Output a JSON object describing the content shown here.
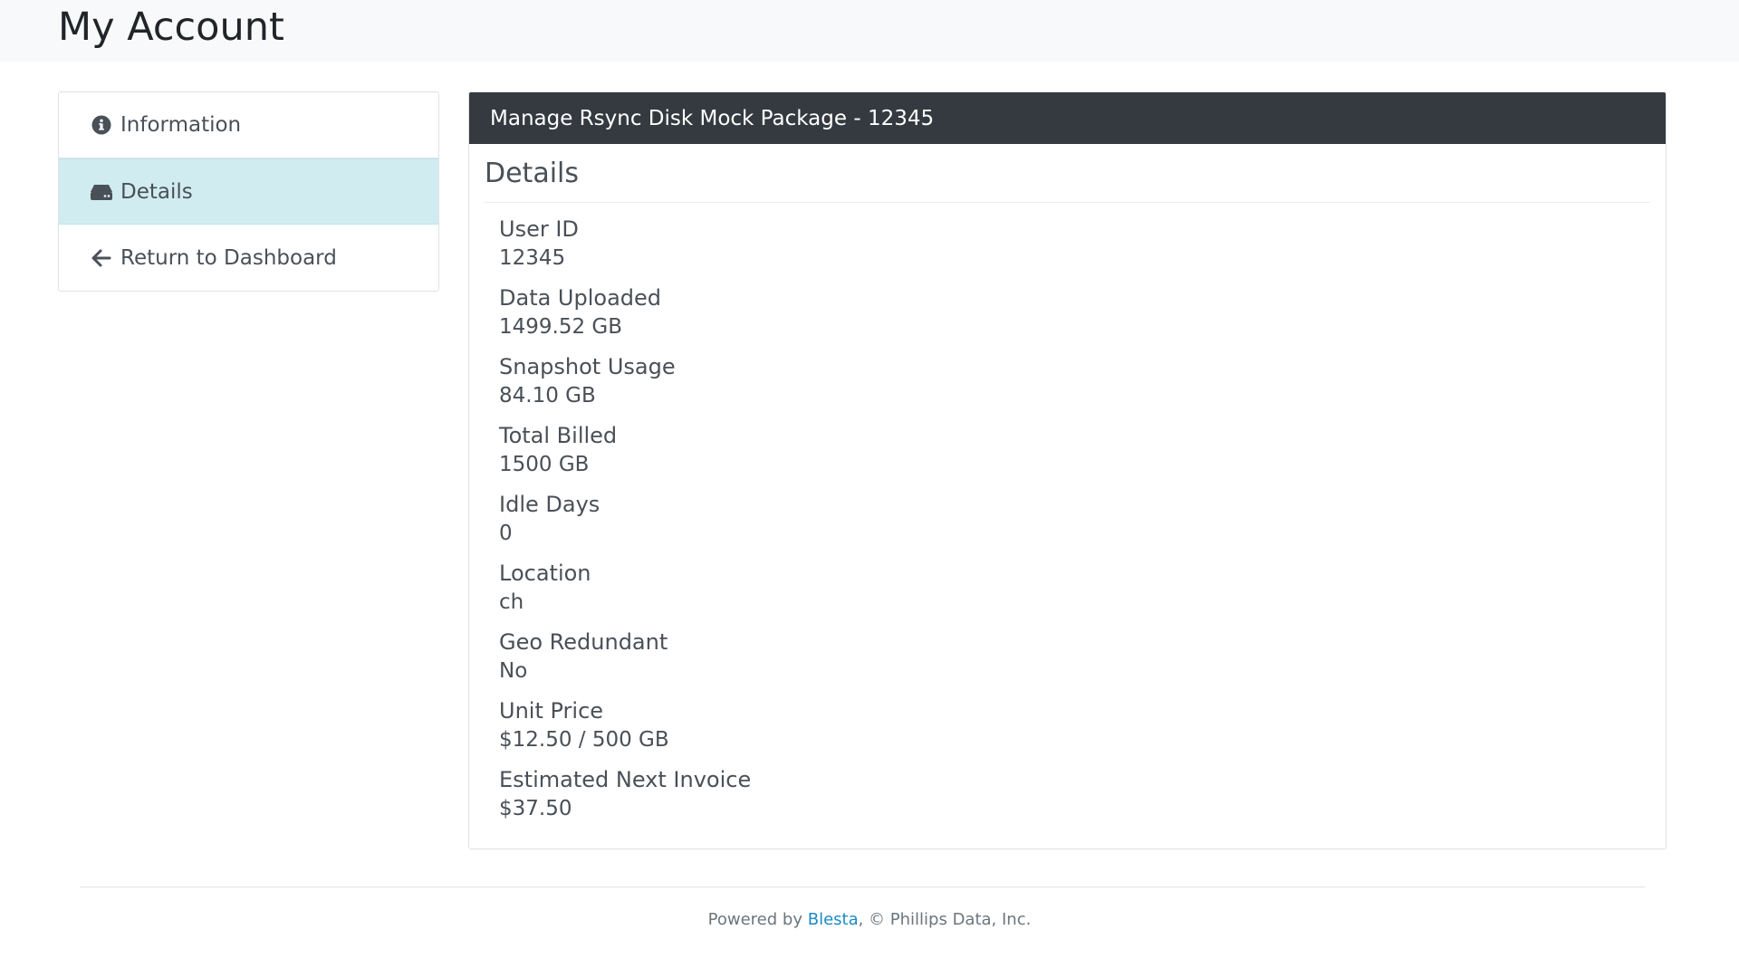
{
  "header": {
    "title": "My Account"
  },
  "sidebar": {
    "items": [
      {
        "label": "Information",
        "icon": "info-circle-icon",
        "active": false
      },
      {
        "label": "Details",
        "icon": "hdd-icon",
        "active": true
      },
      {
        "label": "Return to Dashboard",
        "icon": "arrow-left-icon",
        "active": false
      }
    ]
  },
  "panel": {
    "heading": "Manage Rsync Disk Mock Package - 12345",
    "section_title": "Details",
    "fields": [
      {
        "label": "User ID",
        "value": "12345"
      },
      {
        "label": "Data Uploaded",
        "value": "1499.52 GB"
      },
      {
        "label": "Snapshot Usage",
        "value": "84.10 GB"
      },
      {
        "label": "Total Billed",
        "value": "1500 GB"
      },
      {
        "label": "Idle Days",
        "value": "0"
      },
      {
        "label": "Location",
        "value": "ch"
      },
      {
        "label": "Geo Redundant",
        "value": "No"
      },
      {
        "label": "Unit Price",
        "value": "$12.50 / 500 GB"
      },
      {
        "label": "Estimated Next Invoice",
        "value": "$37.50"
      }
    ]
  },
  "footer": {
    "powered_by": "Powered by ",
    "brand": "Blesta",
    "copyright": ", © Phillips Data, Inc."
  },
  "colors": {
    "header_bg": "#f8f9fa",
    "active_item_bg": "#d1ecf1",
    "panel_heading_bg": "#343a40",
    "link": "#1a8ac8"
  }
}
